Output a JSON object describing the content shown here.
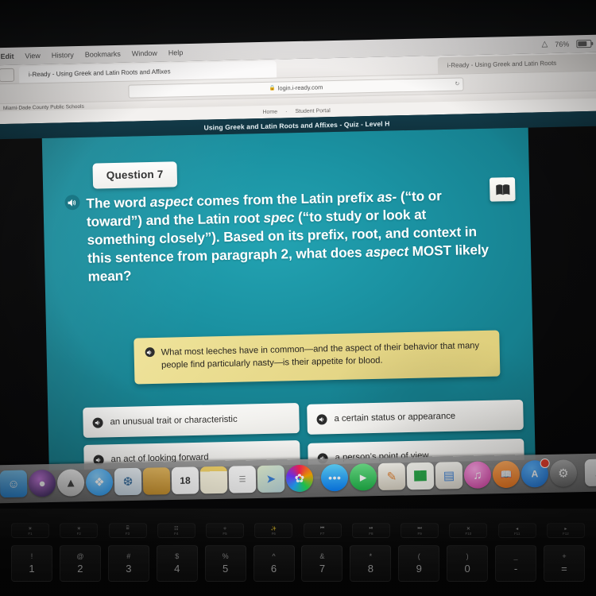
{
  "os": {
    "menubar": {
      "items": [
        "Edit",
        "View",
        "History",
        "Bookmarks",
        "Window",
        "Help"
      ],
      "wifi_icon": "wifi-icon",
      "battery_icon": "battery-icon",
      "battery_label": "76%"
    },
    "dock": {
      "items": [
        {
          "name": "finder",
          "glyph": "☺",
          "color": "#2f8fe0"
        },
        {
          "name": "siri",
          "glyph": "●",
          "color": "#2b2350"
        },
        {
          "name": "launchpad",
          "glyph": "🚀",
          "color": "#d8d8d8"
        },
        {
          "name": "safari",
          "glyph": "✶",
          "color": "#2196f3"
        },
        {
          "name": "photos",
          "glyph": "❆",
          "color": "#dfe6ec"
        },
        {
          "name": "folder",
          "glyph": "",
          "color": "#d9a343"
        },
        {
          "name": "calendar",
          "glyph": "18",
          "color": "#ffffff"
        },
        {
          "name": "notes",
          "glyph": "",
          "color": "#fdf6d8"
        },
        {
          "name": "reminders",
          "glyph": "☰",
          "color": "#fbfbfb"
        },
        {
          "name": "maps",
          "glyph": "✈",
          "color": "#e7eedd"
        },
        {
          "name": "photos-wheel",
          "glyph": "✿",
          "color": "#f2f2f2"
        },
        {
          "name": "messages",
          "glyph": "●●●",
          "color": "#32c24d"
        },
        {
          "name": "facetime",
          "glyph": "▶",
          "color": "#35c759"
        },
        {
          "name": "pages",
          "glyph": "✎",
          "color": "#f2efe8"
        },
        {
          "name": "numbers",
          "glyph": "█",
          "color": "#f5f5f0"
        },
        {
          "name": "keynote",
          "glyph": "▤",
          "color": "#e9e6de"
        },
        {
          "name": "itunes",
          "glyph": "♫",
          "color": "#e86fc4"
        },
        {
          "name": "ibooks",
          "glyph": "📖",
          "color": "#f2833c"
        },
        {
          "name": "app-store",
          "glyph": "A",
          "color": "#2a8cf0",
          "badge": true
        },
        {
          "name": "system-preferences",
          "glyph": "⚙",
          "color": "#8d8d8d"
        },
        {
          "name": "documents",
          "glyph": "",
          "color": "#e7e7e7"
        },
        {
          "name": "trash",
          "glyph": "□",
          "color": "#cfcfcf"
        }
      ]
    },
    "keyboard": {
      "function_keys": [
        {
          "glyph": "☀",
          "label": "F1"
        },
        {
          "glyph": "☀",
          "label": "F2"
        },
        {
          "glyph": "⌸",
          "label": "F3"
        },
        {
          "glyph": "☷",
          "label": "F4"
        },
        {
          "glyph": "✧",
          "label": "F5"
        },
        {
          "glyph": "✨",
          "label": "F6"
        },
        {
          "glyph": "⏮",
          "label": "F7"
        },
        {
          "glyph": "⏯",
          "label": "F8"
        },
        {
          "glyph": "⏭",
          "label": "F9"
        },
        {
          "glyph": "✕",
          "label": "F10"
        },
        {
          "glyph": "◂",
          "label": "F11"
        },
        {
          "glyph": "▸",
          "label": "F12"
        }
      ],
      "number_keys": [
        {
          "top": "!",
          "bottom": "1"
        },
        {
          "top": "@",
          "bottom": "2"
        },
        {
          "top": "#",
          "bottom": "3"
        },
        {
          "top": "$",
          "bottom": "4"
        },
        {
          "top": "%",
          "bottom": "5"
        },
        {
          "top": "^",
          "bottom": "6"
        },
        {
          "top": "&",
          "bottom": "7"
        },
        {
          "top": "*",
          "bottom": "8"
        },
        {
          "top": "(",
          "bottom": "9"
        },
        {
          "top": ")",
          "bottom": "0"
        },
        {
          "top": "_",
          "bottom": "-"
        },
        {
          "top": "+",
          "bottom": "="
        }
      ]
    }
  },
  "browser": {
    "active_tab_title": "i-Ready - Using Greek and Latin Roots and Affixes",
    "inactive_tab_title": "i-Ready - Using Greek and Latin Roots",
    "url": "login.i-ready.com",
    "lock_icon": "lock-icon",
    "reload_icon": "reload-icon",
    "bookmark": "Miami-Dade County Public Schools",
    "sidebar_icon": "sidebar-toggle-icon"
  },
  "page_nav": {
    "home": "Home",
    "separator": "·",
    "portal": "Student Portal"
  },
  "lesson": {
    "title": "Using Greek and Latin Roots and Affixes - Quiz - Level H"
  },
  "quiz": {
    "question_tab_label": "Question 7",
    "bookmark_icon": "book-icon",
    "speaker_icon": "speaker-icon",
    "question_text_parts": {
      "a": "The word ",
      "b_italic": "aspect",
      "c": " comes from the Latin prefix ",
      "d_italic": "as-",
      "e": " (“to or toward”) and the Latin root ",
      "f_italic": "spec",
      "g": " (“to study or look at something closely”). Based on its prefix, root, and context in this sentence from paragraph 2, what does ",
      "h_italic": "aspect",
      "i": " MOST likely mean?"
    },
    "passage": "What most leeches have in common—and the aspect of their behavior that many people find particularly nasty—is their appetite for blood.",
    "choices": [
      {
        "label": "an unusual trait or characteristic",
        "speaker_icon": "speaker-icon"
      },
      {
        "label": "a certain status or appearance",
        "speaker_icon": "speaker-icon"
      },
      {
        "label": "an act of looking forward",
        "speaker_icon": "speaker-icon"
      },
      {
        "label": "a person’s point of view",
        "speaker_icon": "speaker-icon"
      }
    ]
  },
  "media_bar": {
    "volume_icon": "volume-icon",
    "scrubber_name": "audio-scrubber",
    "transport": [
      {
        "name": "skip-to-start-icon",
        "glyph": "⏮"
      },
      {
        "name": "rewind-icon",
        "glyph": "⏪"
      },
      {
        "name": "play-icon",
        "glyph": "▶"
      },
      {
        "name": "fast-forward-icon",
        "glyph": "⏩"
      },
      {
        "name": "skip-to-end-icon",
        "glyph": "⏭"
      }
    ],
    "tools": [
      {
        "name": "highlighter-tool-icon",
        "glyph": "✏"
      },
      {
        "name": "notes-tool-icon",
        "glyph": "☰"
      },
      {
        "name": "eraser-tool-icon",
        "glyph": "◧"
      },
      {
        "name": "settings-tool-icon",
        "glyph": "◎"
      }
    ]
  },
  "colors": {
    "stage_teal": "#1b93a3",
    "passage_yellow": "#e8da8c",
    "title_bar": "#123a48",
    "answer_card": "#f4f3f0"
  }
}
